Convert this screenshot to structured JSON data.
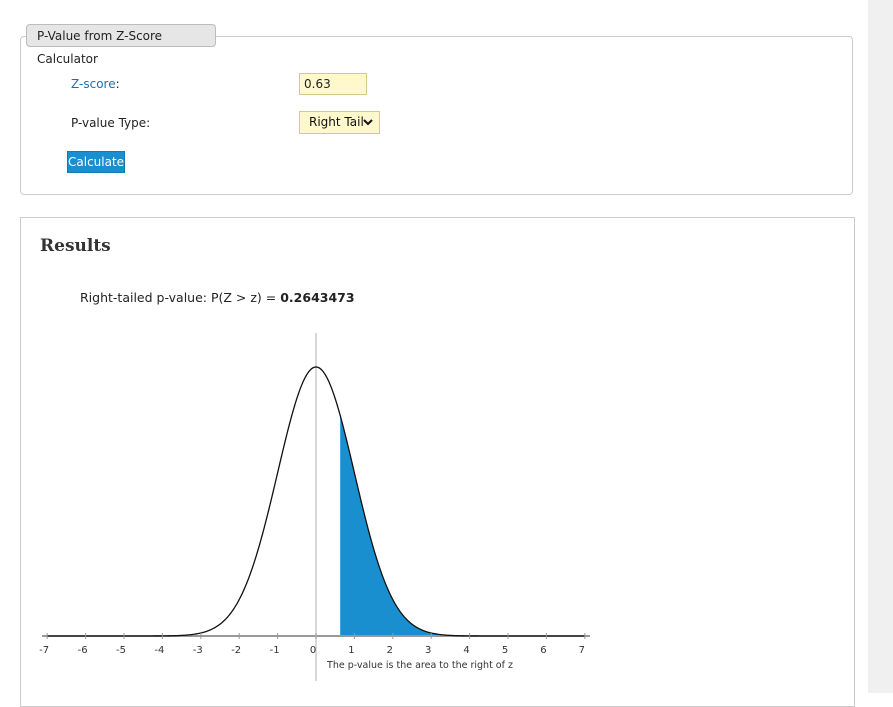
{
  "calculator": {
    "title": "P-Value from Z-Score Calculator",
    "zscore_label": "Z-score",
    "zscore_value": "0.63",
    "ptype_label": "P-value Type:",
    "ptype_selected": "Right Tail",
    "calculate_label": "Calculate"
  },
  "results": {
    "title": "Results",
    "result_prefix": "Right-tailed p-value: P(Z > z) = ",
    "result_value": "0.2643473"
  },
  "chart_data": {
    "type": "area",
    "distribution": "standard normal",
    "z": 0.63,
    "tail": "right",
    "shaded_color": "#1a8fd0",
    "xlim": [
      -7,
      7
    ],
    "x_ticks": [
      "-7",
      "-6",
      "-5",
      "-4",
      "-3",
      "-2",
      "-1",
      "0",
      "1",
      "2",
      "3",
      "4",
      "5",
      "6",
      "7"
    ],
    "caption": "The p-value is the area to the right of z"
  }
}
